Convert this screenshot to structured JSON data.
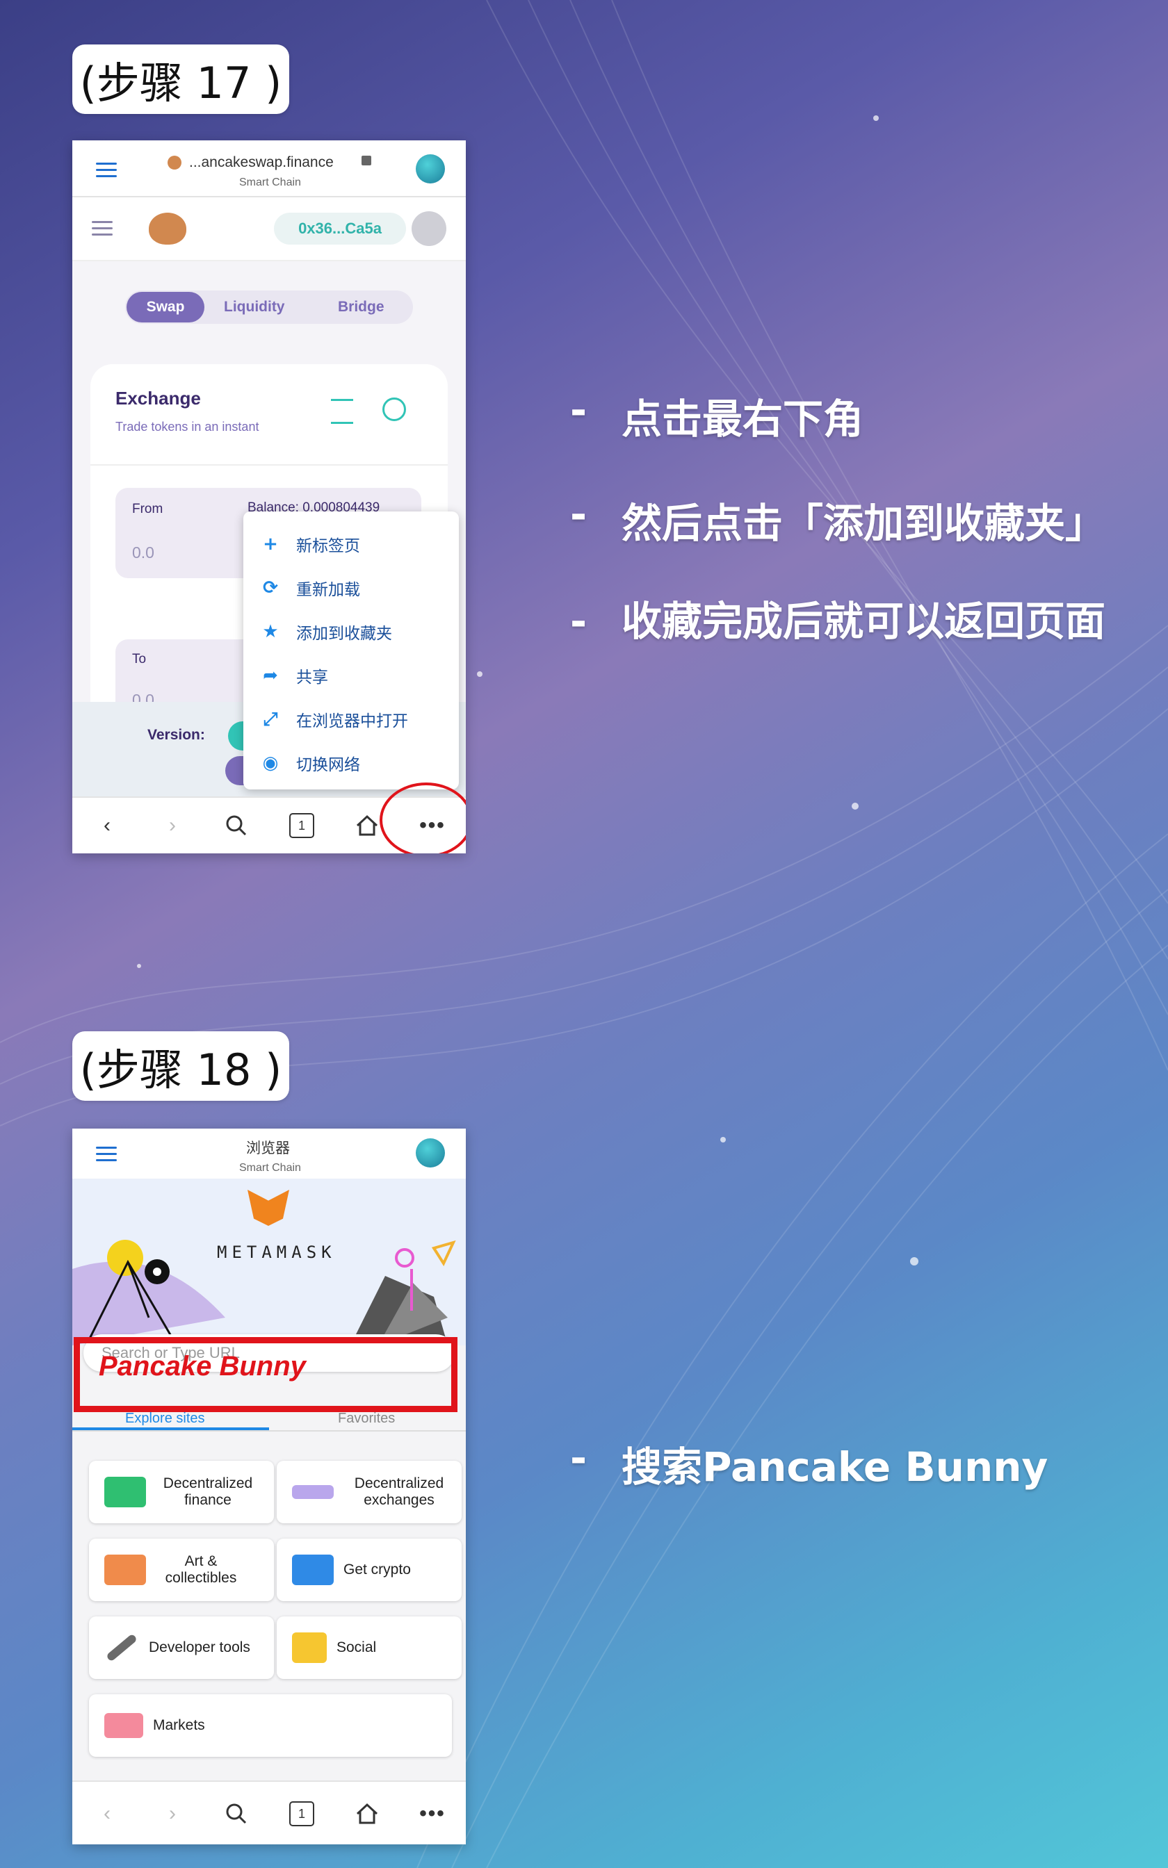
{
  "step17": {
    "label": "(步骤 17 )",
    "topbar": {
      "domain": "...ancakeswap.finance",
      "network": "Smart Chain"
    },
    "app": {
      "address": "0x36...Ca5a"
    },
    "tabs": [
      "Swap",
      "Liquidity",
      "Bridge"
    ],
    "exchange": {
      "title": "Exchange",
      "subtitle": "Trade tokens in an instant"
    },
    "from": {
      "label": "From",
      "balance": "Balance: 0.000804439",
      "amount": "0.0"
    },
    "to": {
      "label": "To",
      "amount": "0.0"
    },
    "version_label": "Version:",
    "menu": [
      "新标签页",
      "重新加载",
      "添加到收藏夹",
      "共享",
      "在浏览器中打开",
      "切换网络"
    ],
    "tab_count": "1"
  },
  "step18": {
    "label": "(步骤 18 )",
    "topbar": {
      "title": "浏览器",
      "network": "Smart Chain"
    },
    "brand": "METAMASK",
    "search": {
      "placeholder": "Search or Type URL",
      "overlay": "Pancake Bunny"
    },
    "tabs": [
      "Explore sites",
      "Favorites"
    ],
    "tiles": [
      "Decentralized finance",
      "Decentralized exchanges",
      "Art & collectibles",
      "Get crypto",
      "Developer tools",
      "Social",
      "Markets"
    ],
    "tab_count": "1"
  },
  "bullets": {
    "b1": "点击最右下角",
    "b2": "然后点击「添加到收藏夹」",
    "b3": "收藏完成后就可以返回页面",
    "b4": "搜索Pancake Bunny",
    "dash": "-"
  },
  "colors": {
    "accent_purple": "#7a6bb8",
    "teal": "#31d0aa",
    "highlight_red": "#e0141b",
    "link_blue": "#1e88e5"
  }
}
